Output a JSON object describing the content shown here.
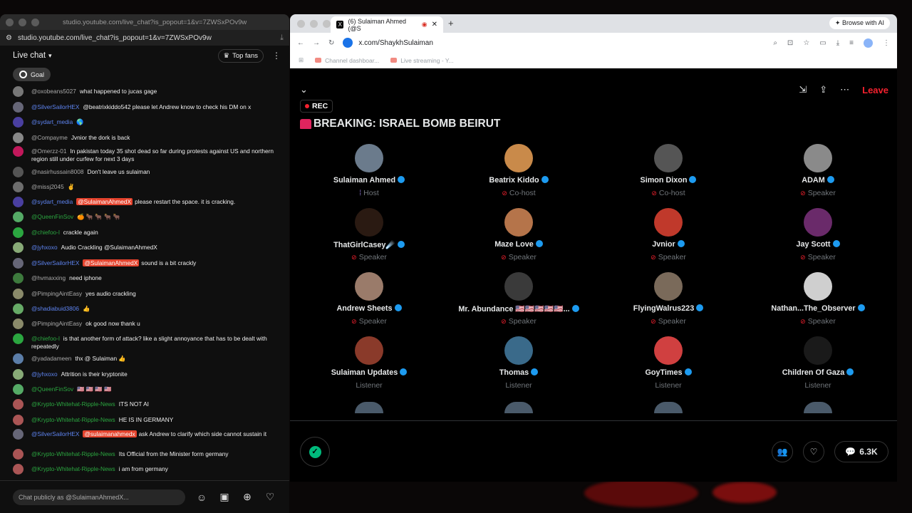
{
  "chat_window": {
    "title": "studio.youtube.com/live_chat?is_popout=1&v=7ZWSxPOv9w",
    "url": "studio.youtube.com/live_chat?is_popout=1&v=7ZWSxPOv9w",
    "header_label": "Live chat",
    "top_fans_label": "Top fans",
    "goal_label": "Goal",
    "input_placeholder": "Chat publicly as @SulaimanAhmedX...",
    "messages": [
      {
        "author": "@oxobeans5027",
        "mention": "",
        "text": "what happened to jucas gage",
        "avatar": "#777",
        "color": ""
      },
      {
        "author": "@SilverSailorHEX",
        "mention": "",
        "text": "@beatrixkiddo542 please let Andrew know to check his DM on x",
        "avatar": "#667",
        "color": "blue"
      },
      {
        "author": "@sydart_media",
        "mention": "",
        "text": "🌎",
        "avatar": "#4a3fa0",
        "color": "blue"
      },
      {
        "author": "@Compayme",
        "mention": "",
        "text": "Jvnior the dork is back",
        "avatar": "#888",
        "color": ""
      },
      {
        "author": "@Omerzz-01",
        "mention": "",
        "text": "In pakistan today 35 shot dead so far during protests against US and northern region still under curfew for next 3 days",
        "avatar": "#c2185b",
        "color": ""
      },
      {
        "author": "@nasirhussain8008",
        "mention": "",
        "text": "Don't leave us sulaiman",
        "avatar": "#555",
        "color": ""
      },
      {
        "author": "@missj2045",
        "mention": "",
        "text": "✌",
        "avatar": "#6d6d6d",
        "color": ""
      },
      {
        "author": "@sydart_media",
        "mention": "@SulaimanAhmedX",
        "text": "please restart the space. it is cracking.",
        "avatar": "#4a3fa0",
        "color": "blue"
      },
      {
        "author": "@QueenFinSov",
        "mention": "",
        "text": "🍊 🐂 🐂 🐂 🐂",
        "avatar": "#5a6",
        "color": "member"
      },
      {
        "author": "@chiefoo-l",
        "mention": "",
        "text": "crackle again",
        "avatar": "#2ba640",
        "color": "member"
      },
      {
        "author": "@jyhxoxo",
        "mention": "",
        "text": "Audio Crackling @SulaimanAhmedX",
        "avatar": "#8a7",
        "color": "blue"
      },
      {
        "author": "@SilverSailorHEX",
        "mention": "@SulaimanAhmedX",
        "text": "sound is a bit crackly",
        "avatar": "#667",
        "color": "blue"
      },
      {
        "author": "@hvmaxxing",
        "mention": "",
        "text": "need iphone",
        "avatar": "#3d7a3d",
        "color": ""
      },
      {
        "author": "@PimpingAintEasy",
        "mention": "",
        "text": "yes audio crackling",
        "avatar": "#8a8a6a",
        "color": ""
      },
      {
        "author": "@shadiabuid3806",
        "mention": "",
        "text": "👍",
        "avatar": "#6a6",
        "color": "blue"
      },
      {
        "author": "@PimpingAintEasy",
        "mention": "",
        "text": "ok good now thank u",
        "avatar": "#8a8a6a",
        "color": ""
      },
      {
        "author": "@chiefoo-l",
        "mention": "",
        "text": "is that another form of attack? like a slight annoyance that has to be dealt with repeatedly",
        "avatar": "#2ba640",
        "color": "member"
      },
      {
        "author": "@yadadameen",
        "mention": "",
        "text": "thx @ Sulaiman 👍",
        "avatar": "#5b7da8",
        "color": ""
      },
      {
        "author": "@jyhxoxo",
        "mention": "",
        "text": "Attrition is their kryptonite",
        "avatar": "#8a7",
        "color": "blue"
      },
      {
        "author": "@QueenFinSov",
        "mention": "",
        "text": "🇺🇸 🇺🇸 🇺🇸 🇺🇸",
        "avatar": "#5a6",
        "color": "member"
      },
      {
        "author": "@Krypto-Whitehat-Ripple-News",
        "mention": "",
        "text": "ITS NOT AI",
        "avatar": "#a55",
        "color": "member"
      },
      {
        "author": "@Krypto-Whitehat-Ripple-News",
        "mention": "",
        "text": "HE IS IN GERMANY",
        "avatar": "#a55",
        "color": "member"
      },
      {
        "author": "@SilverSailorHEX",
        "mention": "@sulaimanahmedx",
        "text": "ask Andrew to clarify which side cannot sustain it",
        "avatar": "#667",
        "color": "blue"
      },
      {
        "author": "@Krypto-Whitehat-Ripple-News",
        "mention": "",
        "text": "Its Official from the Minister form germany",
        "avatar": "#a55",
        "color": "member"
      },
      {
        "author": "@Krypto-Whitehat-Ripple-News",
        "mention": "",
        "text": "i am from germany",
        "avatar": "#a55",
        "color": "member"
      }
    ]
  },
  "x_window": {
    "tab_title": "(6) Sulaiman Ahmed (@S",
    "browse_ai_label": "Browse with AI",
    "url": "x.com/ShaykhSulaiman",
    "bookmarks": [
      "Channel dashboar...",
      "Live streaming - Y..."
    ],
    "leave_label": "Leave",
    "rec_label": "REC",
    "space_title": "BREAKING: ISRAEL BOMB BEIRUT",
    "listener_count": "6.3K",
    "participants": [
      {
        "name": "Sulaiman Ahmed",
        "role": "Host",
        "avatar": "#6b7b8c",
        "muted": false
      },
      {
        "name": "Beatrix Kiddo",
        "role": "Co-host",
        "avatar": "#c98a4a",
        "muted": true
      },
      {
        "name": "Simon Dixon",
        "role": "Co-host",
        "avatar": "#555555",
        "muted": true
      },
      {
        "name": "ADAM",
        "role": "Speaker",
        "avatar": "#8a8a8a",
        "muted": true
      },
      {
        "name": "ThatGirlCasey☄️",
        "role": "Speaker",
        "avatar": "#2a1a12",
        "muted": true
      },
      {
        "name": "Maze Love",
        "role": "Speaker",
        "avatar": "#b5744a",
        "muted": true
      },
      {
        "name": "Jvnior",
        "role": "Speaker",
        "avatar": "#c0392b",
        "muted": true
      },
      {
        "name": "Jay Scott",
        "role": "Speaker",
        "avatar": "#6a2a6a",
        "muted": true
      },
      {
        "name": "Andrew Sheets",
        "role": "Speaker",
        "avatar": "#9a7b6a",
        "muted": true
      },
      {
        "name": "Mr. Abundance 🇺🇸🇺🇸🇺🇸🇺🇸🇺🇸...",
        "role": "Speaker",
        "avatar": "#3a3a3a",
        "muted": true
      },
      {
        "name": "FlyingWalrus223",
        "role": "Speaker",
        "avatar": "#7a6a5a",
        "muted": true
      },
      {
        "name": "Nathan...The_Observer",
        "role": "Speaker",
        "avatar": "#cfcfcf",
        "muted": true
      },
      {
        "name": "Sulaiman Updates",
        "role": "Listener",
        "avatar": "#8a3a2a",
        "muted": false
      },
      {
        "name": "Thomas",
        "role": "Listener",
        "avatar": "#3a6a8a",
        "muted": false
      },
      {
        "name": "GoyTimes",
        "role": "Listener",
        "avatar": "#d04040",
        "muted": false
      },
      {
        "name": "Children Of Gaza",
        "role": "Listener",
        "avatar": "#1a1a1a",
        "muted": false
      }
    ]
  }
}
